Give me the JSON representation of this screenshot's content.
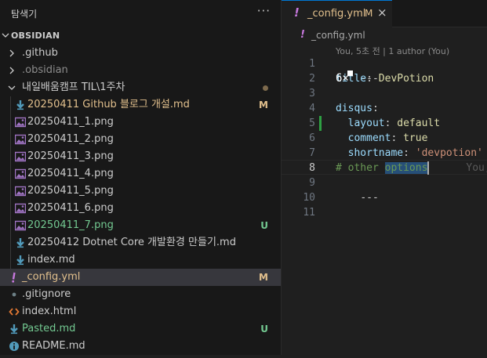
{
  "explorer": {
    "title": "탐색기",
    "more": "···",
    "section": "OBSIDIAN",
    "items": [
      {
        "label": ".github",
        "kind": "folder",
        "status": "normal"
      },
      {
        "label": ".obsidian",
        "kind": "folder",
        "status": "ignored"
      },
      {
        "label": "내일배움캠프 TIL\\1주차",
        "kind": "folder-open",
        "status": "modified-dot"
      },
      {
        "label": "20250411 Github 블로그 개설.md",
        "kind": "md",
        "status": "modified",
        "badge": "M"
      },
      {
        "label": "20250411_1.png",
        "kind": "png",
        "status": "normal"
      },
      {
        "label": "20250411_2.png",
        "kind": "png",
        "status": "normal"
      },
      {
        "label": "20250411_3.png",
        "kind": "png",
        "status": "normal"
      },
      {
        "label": "20250411_4.png",
        "kind": "png",
        "status": "normal"
      },
      {
        "label": "20250411_5.png",
        "kind": "png",
        "status": "normal"
      },
      {
        "label": "20250411_6.png",
        "kind": "png",
        "status": "normal"
      },
      {
        "label": "20250411_7.png",
        "kind": "png",
        "status": "untracked",
        "badge": "U"
      },
      {
        "label": "20250412 Dotnet Core 개발환경 만들기.md",
        "kind": "md",
        "status": "normal"
      },
      {
        "label": "index.md",
        "kind": "md",
        "status": "normal"
      },
      {
        "label": "_config.yml",
        "kind": "yml",
        "status": "modified",
        "badge": "M",
        "selected": true
      },
      {
        "label": ".gitignore",
        "kind": "gitignore",
        "status": "normal"
      },
      {
        "label": "index.html",
        "kind": "html",
        "status": "normal"
      },
      {
        "label": "Pasted.md",
        "kind": "md",
        "status": "untracked",
        "badge": "U"
      },
      {
        "label": "README.md",
        "kind": "info",
        "status": "normal"
      }
    ]
  },
  "editor": {
    "tab": {
      "label": "_config.yml",
      "badge": "M",
      "close": "×"
    },
    "breadcrumb": "_config.yml",
    "codelens": "You, 5초 전 | 1 author (You)",
    "overlay_text": "6×",
    "line_numbers": [
      "1",
      "2",
      "3",
      "4",
      "5",
      "6",
      "7",
      "8",
      "9",
      "10",
      "11"
    ],
    "active_line": "8",
    "code": {
      "l1": "---",
      "l2_key": "title",
      "l2_val": "DevPotion",
      "l4_key": "disqus",
      "l5_key": "layout",
      "l5_val": "default",
      "l6_key": "comment",
      "l6_val": "true",
      "l7_key": "shortname",
      "l7_val": "'devpotion'",
      "l8_comment_a": "# other ",
      "l8_comment_sel": "options",
      "l8_blame": "You, ",
      "l9": "---"
    }
  },
  "colors": {
    "accent": "#0078d4",
    "modified": "#e2c08d",
    "untracked": "#73c991",
    "md_icon": "#519aba",
    "png_icon": "#a074c4",
    "yml_icon": "#c678dd"
  }
}
